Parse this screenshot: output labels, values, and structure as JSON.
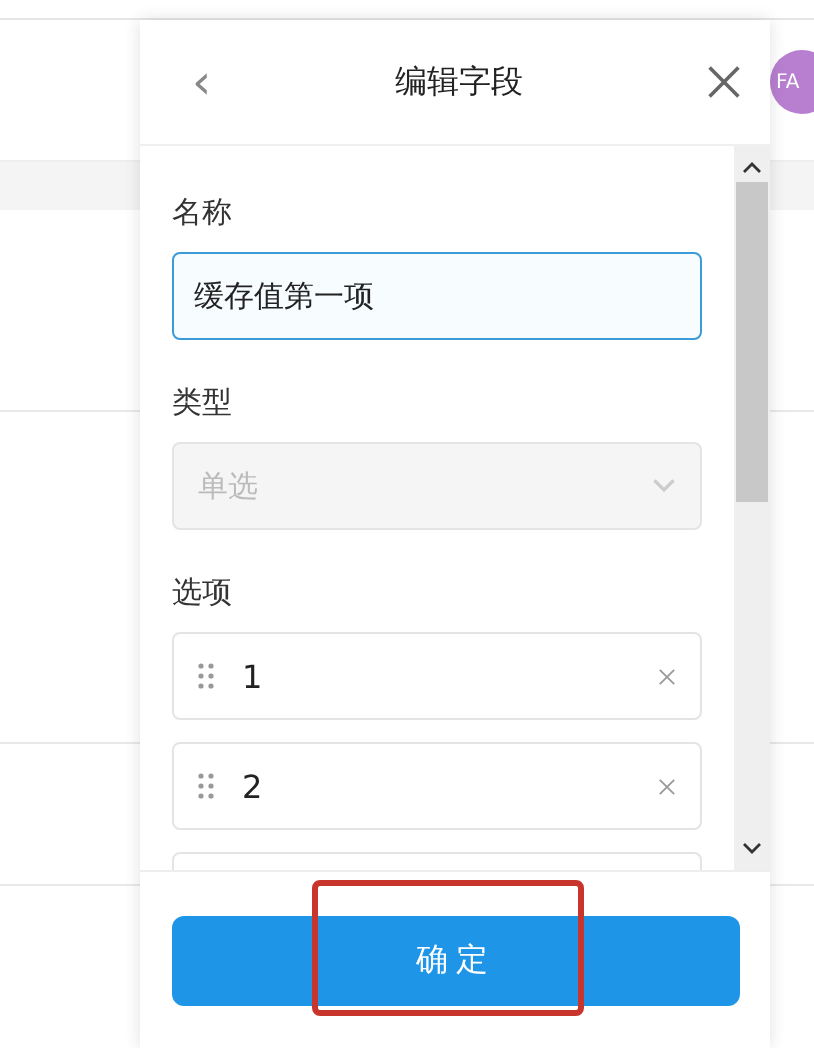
{
  "avatar": {
    "initials": "FA"
  },
  "panel": {
    "title": "编辑字段",
    "back_icon": "‹",
    "fields": [
      {
        "kind": "text",
        "label": "名称",
        "value": "缓存值第一项",
        "focused": true
      },
      {
        "kind": "select",
        "label": "类型",
        "value": "单选",
        "disabled": true
      }
    ],
    "options": {
      "label": "选项",
      "items": [
        {
          "value": "1"
        },
        {
          "value": "2"
        }
      ]
    },
    "confirm": {
      "label": "确定",
      "highlighted": true
    }
  }
}
